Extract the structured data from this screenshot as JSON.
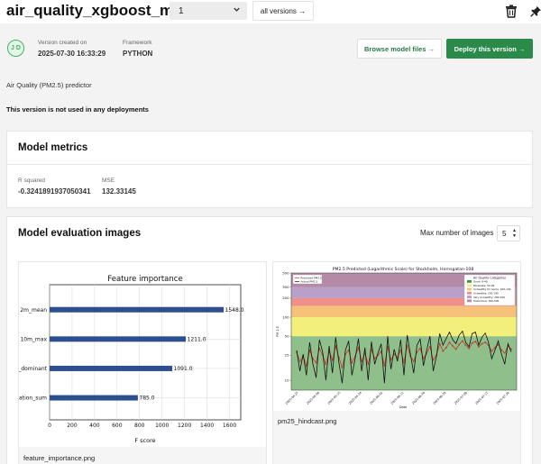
{
  "header": {
    "model_name": "air_quality_xgboost_model",
    "version_value": "1",
    "all_versions_label": "all versions →"
  },
  "version_info": {
    "avatar_initials": "J D",
    "created_label": "Version created on",
    "created_value": "2025-07-30 16:33:29",
    "framework_label": "Framework",
    "framework_value": "PYTHON",
    "browse_label": "Browse model files →",
    "deploy_label": "Deploy this version →",
    "description": "Air Quality (PM2.5) predictor",
    "deployment_status": "This version is not used in any deployments"
  },
  "metrics": {
    "title": "Model metrics",
    "items": [
      {
        "label": "R squared",
        "value": "-0.3241891937050341"
      },
      {
        "label": "MSE",
        "value": "132.33145"
      }
    ]
  },
  "evaluation": {
    "title": "Model evaluation images",
    "max_label": "Max number of images",
    "max_value": "5",
    "images": [
      {
        "caption": "feature_importance.png"
      },
      {
        "caption": "pm25_hindcast.png"
      }
    ]
  },
  "colors": {
    "accent": "#2a8a4a",
    "bar": "#2c4f8f"
  },
  "chart_data": [
    {
      "type": "bar",
      "orientation": "horizontal",
      "title": "Feature importance",
      "xlabel": "F score",
      "ylabel": "",
      "categories": [
        "2m_mean",
        "10m_max",
        "_dominant",
        "ation_sum"
      ],
      "values": [
        1548.0,
        1211.0,
        1091.0,
        785.0
      ],
      "value_labels": [
        "1548.0",
        "1211.0",
        "1091.0",
        "785.0"
      ],
      "xlim": [
        0,
        1700
      ],
      "xticks": [
        "0",
        "200",
        "400",
        "600",
        "800",
        "1000",
        "1200",
        "1400",
        "1600"
      ],
      "grid": true
    },
    {
      "type": "line",
      "title": "PM2.5 Predicted (Logarithmic Scale) for Stockholm, Hornsgatan-108",
      "xlabel": "Date",
      "ylabel": "PM 2.5",
      "y_scale": "log",
      "yticks": [
        "500",
        "300",
        "200",
        "100",
        "50",
        "25",
        "10"
      ],
      "xticks": [
        "2025-04-27",
        "2025-05-06",
        "2025-05-15",
        "2025-05-24",
        "2025-06-02",
        "2025-06-11",
        "2025-06-20",
        "2025-06-29",
        "2025-07-08",
        "2025-07-17",
        "2025-07-26"
      ],
      "legend_position": "top-left",
      "series": [
        {
          "name": "Predicted PM2.5",
          "color": "#c0392b",
          "marker": "o",
          "values": [
            28,
            20,
            24,
            17,
            30,
            22,
            19,
            32,
            25,
            18,
            29,
            21,
            35,
            23,
            16,
            26,
            30,
            19,
            24,
            33,
            20,
            27,
            18,
            31,
            22,
            25,
            29,
            17,
            34,
            21,
            26,
            23,
            30,
            19,
            36,
            24,
            20,
            28,
            32,
            22,
            27,
            34,
            21,
            25,
            38,
            29,
            33,
            40,
            35,
            31,
            37,
            42,
            36,
            32,
            39,
            41,
            34,
            38,
            40,
            36,
            29,
            33,
            37,
            30,
            27,
            35,
            31
          ]
        },
        {
          "name": "Actual PM2.5",
          "color": "#111111",
          "marker": "none",
          "values": [
            30,
            14,
            26,
            12,
            40,
            18,
            11,
            44,
            28,
            10,
            35,
            13,
            48,
            19,
            9,
            30,
            42,
            12,
            22,
            46,
            14,
            33,
            10,
            41,
            18,
            27,
            38,
            9,
            50,
            15,
            31,
            20,
            44,
            12,
            52,
            26,
            13,
            36,
            45,
            17,
            30,
            50,
            14,
            24,
            55,
            36,
            46,
            58,
            44,
            38,
            52,
            60,
            40,
            34,
            55,
            58,
            36,
            48,
            56,
            40,
            22,
            30,
            42,
            26,
            18,
            38,
            28
          ]
        }
      ],
      "category_bands": {
        "title": "Air Quality Categories",
        "items": [
          {
            "label": "Good: 0-49",
            "color": "#8fbf8a",
            "range": [
              0,
              50
            ]
          },
          {
            "label": "Moderate: 50-99",
            "color": "#f2f07a",
            "range": [
              50,
              100
            ]
          },
          {
            "label": "Unhealthy for Some: 100-149",
            "color": "#f6c27a",
            "range": [
              100,
              150
            ]
          },
          {
            "label": "Unhealthy: 150-199",
            "color": "#ef8f8a",
            "range": [
              150,
              200
            ]
          },
          {
            "label": "Very Unhealthy: 200-299",
            "color": "#b9a0c8",
            "range": [
              200,
              300
            ]
          },
          {
            "label": "Hazardous: 300-500",
            "color": "#b58aa6",
            "range": [
              300,
              500
            ]
          }
        ]
      }
    }
  ]
}
